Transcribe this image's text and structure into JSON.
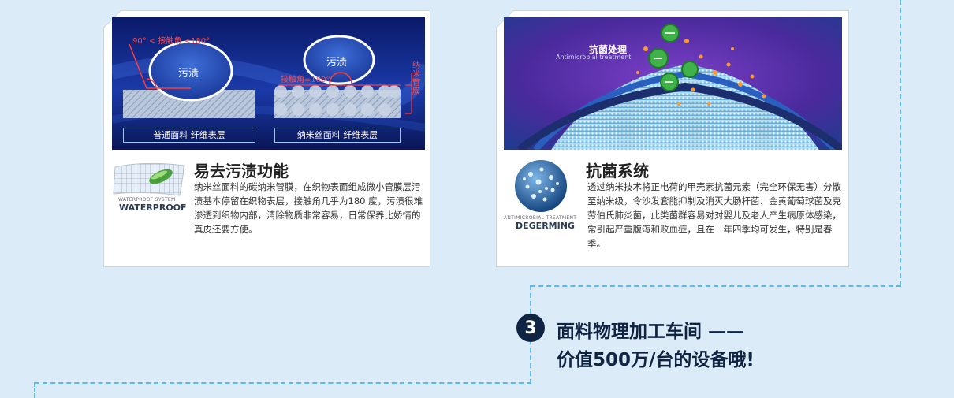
{
  "features": [
    {
      "banner": {
        "angle_label": "90° < 接触角 <180°",
        "stain_left": "污渍",
        "stain_right": "污渍",
        "contact_label": "接触角=180°",
        "membrane_label": "纳米管膜",
        "caption_left": "普通面料 纤维表层",
        "caption_right": "纳米丝面料 纤维表层"
      },
      "logo_caption": "WATERPROOF SYSTEM",
      "logo_word": "WATERPROOF",
      "logo_icon": "waterproof-fabric-icon",
      "title": "易去污渍功能",
      "description": "纳米丝面料的碳纳米管膜，在织物表面组成微小管膜层污渍基本停留在织物表层，接触角几乎为180 度，污渍很难渗透到织物内部，清除物质非常容易，日常保养比娇情的真皮还要方便。"
    },
    {
      "banner": {
        "title": "抗菌处理",
        "subtitle": "Antimicrobial treatment"
      },
      "logo_caption": "ANTIMICROBIAL TREATMENT",
      "logo_word": "DEGERMING",
      "logo_icon": "degerming-sphere-icon",
      "title": "抗菌系统",
      "description": "透过纳米技术将正电荷的甲壳素抗菌元素（完全环保无害）分散至纳米级，令沙发套能抑制及消灭大肠杆菌、金黄葡萄球菌及克劳伯氏肺炎菌，此类菌群容易对对婴儿及老人产生病原体感染，常引起严重腹泻和败血症，且在一年四季均可发生，特别是春季。"
    }
  ],
  "step": {
    "number": "3",
    "line1": "面料物理加工车间 ——",
    "line2": "价值500万/台的设备哦!"
  },
  "colors": {
    "background": "#dcebf8",
    "dash": "#5bbbe6",
    "navy": "#0f2343",
    "red_annotation": "#ff3b3b"
  }
}
